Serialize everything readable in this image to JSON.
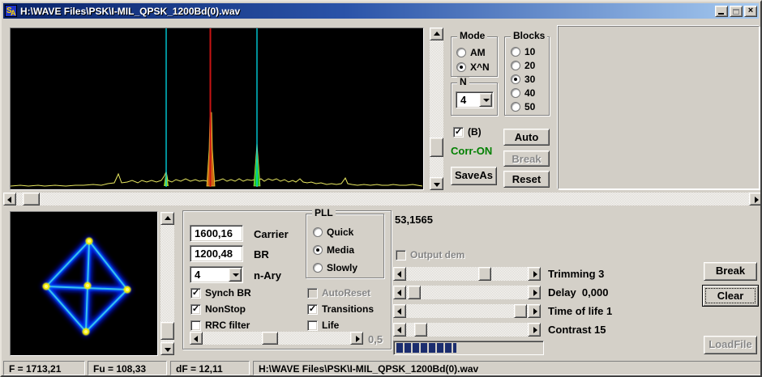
{
  "window": {
    "icon_text": "SA",
    "title": "H:\\WAVE Files\\PSK\\I-MIL_QPSK_1200Bd(0).wav",
    "buttons": {
      "minimize": "minimize",
      "maximize": "maximize",
      "close": "X"
    }
  },
  "spectrum": {
    "type": "line",
    "description": "FFT power spectrum on black background with yellow noise-floor trace",
    "trace_color": "#e8e860",
    "markers": [
      {
        "name": "left-sideband-cursor",
        "color": "#00ccd8",
        "x_frac": 0.378
      },
      {
        "name": "carrier-cursor",
        "color": "#c81414",
        "x_frac": 0.486
      },
      {
        "name": "right-sideband-cursor",
        "color": "#00ccd8",
        "x_frac": 0.598
      }
    ],
    "peaks": [
      {
        "x_frac": 0.486,
        "color": "#d06810",
        "note": "carrier peak"
      },
      {
        "x_frac": 0.598,
        "color": "#22c822",
        "note": "sideband peak"
      },
      {
        "x_frac": 0.378,
        "color": "#a0d820",
        "note": "small sideband peak"
      }
    ]
  },
  "constellation": {
    "description": "QPSK constellation: 4 yellow points in diamond plus center, cyan-blue glowing transition lines",
    "glow_color": "#0040ff",
    "line_color": "#30b8f0",
    "point_color": "#f8f000"
  },
  "mode_group": {
    "title": "Mode",
    "options": [
      "AM",
      "X^N"
    ],
    "selected": "X^N"
  },
  "blocks_group": {
    "title": "Blocks",
    "options": [
      "10",
      "20",
      "30",
      "40",
      "50"
    ],
    "selected": "30"
  },
  "n_group": {
    "title": "N",
    "value": "4"
  },
  "b_check": {
    "label": "(B)",
    "checked": true
  },
  "corr_status": {
    "text": "Corr-ON",
    "color": "#008000"
  },
  "top_buttons": {
    "auto": "Auto",
    "break": "Break",
    "saveas": "SaveAs",
    "reset": "Reset"
  },
  "demod": {
    "carrier": {
      "value": "1600,16",
      "label": "Carrier"
    },
    "br": {
      "value": "1200,48",
      "label": "BR"
    },
    "nary": {
      "value": "4",
      "label": "n-Ary"
    },
    "left_checks": [
      {
        "label": "Synch BR",
        "checked": true
      },
      {
        "label": "NonStop",
        "checked": true
      },
      {
        "label": "RRC filter",
        "checked": false
      }
    ],
    "pll": {
      "title": "PLL",
      "options": [
        "Quick",
        "Media",
        "Slowly"
      ],
      "selected": "Media"
    },
    "right_checks": [
      {
        "label": "AutoReset",
        "checked": false,
        "disabled": true
      },
      {
        "label": "Transitions",
        "checked": true,
        "disabled": false
      },
      {
        "label": "Life",
        "checked": false,
        "disabled": false
      }
    ],
    "aux_slider": {
      "value": "0,5",
      "thumb_frac": 0.45
    }
  },
  "measure_value": "53,1565",
  "output_dem": {
    "label": "Output dem",
    "checked": false,
    "disabled": true
  },
  "sliders": [
    {
      "label": "Trimming 3",
      "thumb_frac": 0.62
    },
    {
      "label": "Delay  0,000",
      "thumb_frac": 0.1
    },
    {
      "label": "Time of life 1",
      "thumb_frac": 0.92
    },
    {
      "label": "Contrast 15",
      "thumb_frac": 0.15
    }
  ],
  "progress": {
    "percent": 40,
    "block_color": "#1b2d6e"
  },
  "side_buttons": {
    "break": "Break",
    "clear": "Clear",
    "loadfile": "LoadFile"
  },
  "status_panels": [
    "F = 1713,21",
    "Fu = 108,33",
    "dF = 12,11",
    "H:\\WAVE Files\\PSK\\I-MIL_QPSK_1200Bd(0).wav"
  ]
}
